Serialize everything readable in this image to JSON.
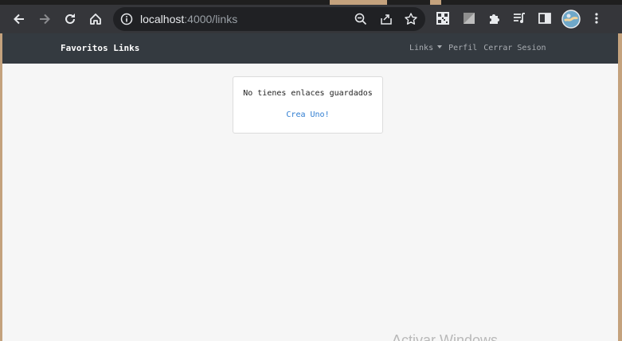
{
  "browser": {
    "url_host": "localhost",
    "url_path": ":4000/links",
    "icons": [
      "back-icon",
      "forward-icon",
      "reload-icon",
      "home-icon",
      "info-icon",
      "zoom-icon",
      "share-icon",
      "star-icon",
      "qr-icon",
      "extension-icon",
      "puzzle-icon",
      "media-icon",
      "sidepanel-icon",
      "avatar",
      "menu-icon"
    ]
  },
  "navbar": {
    "brand": "Favoritos Links",
    "links_label": "Links",
    "profile_label": "Perfil",
    "logout_label": "Cerrar Sesion"
  },
  "card": {
    "message": "No tienes enlaces guardados",
    "create_link": "Crea Uno!"
  },
  "watermark": "Activar Windows",
  "colors": {
    "navbar_bg": "#343a40",
    "link_blue": "#2f7dd1",
    "page_bg": "#f6f6f6"
  }
}
